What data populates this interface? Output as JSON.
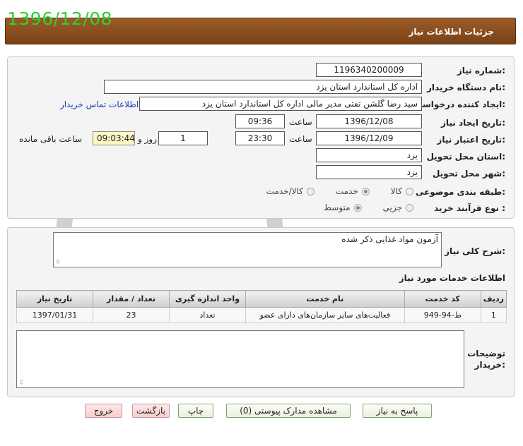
{
  "date_stamp": "1396/12/08",
  "window": {
    "title": "جزئیات اطلاعات نیاز"
  },
  "need_number": {
    "label": "شماره نیاز:",
    "value": "1196340200009"
  },
  "buyer_org": {
    "label": "نام دستگاه خریدار:",
    "value": "اداره کل استاندارد استان یزد"
  },
  "requester": {
    "label": "ایجاد کننده درخواست:",
    "value": "سید رضا  گلشن تفتی مدیر مالی  اداره کل استاندارد استان یزد",
    "contact_link": "اطلاعات تماس خریدار"
  },
  "created": {
    "label": "تاریخ ایجاد نیاز:",
    "date": "1396/12/08",
    "time_label": "ساعت",
    "time": "09:36"
  },
  "validity": {
    "label": "تاریخ اعتبار نیاز:",
    "date": "1396/12/09",
    "time_label": "ساعت",
    "time": "23:30",
    "days": "1",
    "days_label": "روز و",
    "remaining": "09:03:44",
    "remaining_label": "ساعت باقی مانده"
  },
  "province": {
    "label": "استان محل تحویل:",
    "value": "یزد"
  },
  "city": {
    "label": "شهر محل تحویل:",
    "value": "یزد"
  },
  "category": {
    "label": "طبقه بندی موضوعی:",
    "options": [
      {
        "label": "کالا",
        "selected": false
      },
      {
        "label": "خدمت",
        "selected": true
      },
      {
        "label": "کالا/خدمت",
        "selected": false
      }
    ]
  },
  "process_type": {
    "label": "نوع فرآیند خرید :",
    "options": [
      {
        "label": "جزیی",
        "selected": false
      },
      {
        "label": "متوسط",
        "selected": true
      }
    ]
  },
  "description": {
    "label": "شرح کلی نیاز:",
    "value": "آزمون مواد غذایی ذکر شده"
  },
  "services": {
    "heading": "اطلاعات خدمات مورد نیاز",
    "columns": [
      "ردیف",
      "کد خدمت",
      "نام خدمت",
      "واحد اندازه گیری",
      "تعداد / مقدار",
      "تاریخ نیاز"
    ],
    "rows": [
      [
        "1",
        "ط-94-949",
        "فعالیت‌های سایر سازمان‌های دارای عضو",
        "تعداد",
        "23",
        "1397/01/31"
      ]
    ]
  },
  "buyer_notes": {
    "label": "توضیحات خریدار:",
    "value": ""
  },
  "buttons": {
    "reply": "پاسخ به نیاز",
    "attachments": "مشاهده مدارک پیوستی (0)",
    "print": "چاپ",
    "back": "بازگشت",
    "exit": "خروج"
  },
  "colors": {
    "title_bar": "#8b4e1f",
    "date_stamp": "#2fd12f",
    "link": "#1a3fb5"
  }
}
